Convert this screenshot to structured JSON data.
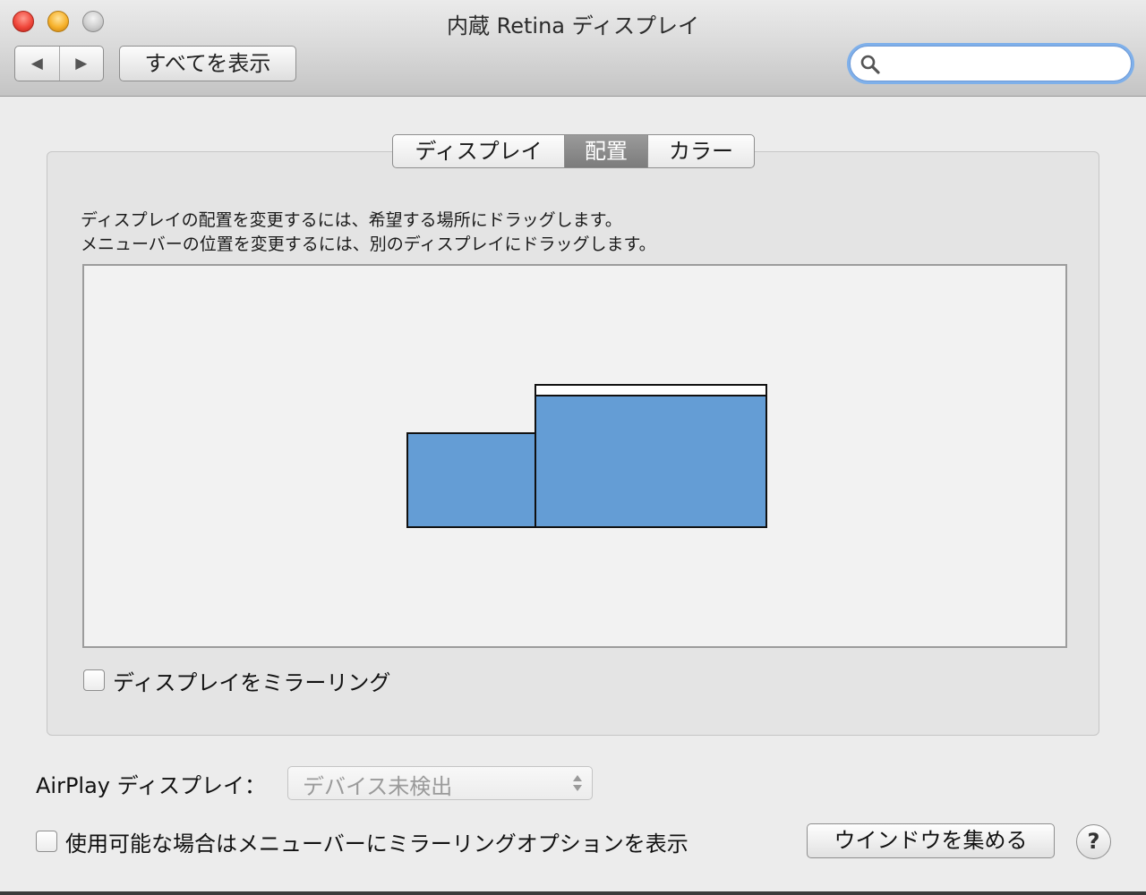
{
  "window": {
    "title": "内蔵 Retina ディスプレイ"
  },
  "toolbar": {
    "back_glyph": "◀",
    "forward_glyph": "▶",
    "show_all_label": "すべてを表示",
    "search": {
      "value": "",
      "placeholder": "",
      "icon": "search-icon"
    }
  },
  "tabs": [
    {
      "label": "ディスプレイ",
      "selected": false
    },
    {
      "label": "配置",
      "selected": true
    },
    {
      "label": "カラー",
      "selected": false
    }
  ],
  "arrangement": {
    "instruction_1": "ディスプレイの配置を変更するには、希望する場所にドラッグします。",
    "instruction_2": "メニューバーの位置を変更するには、別のディスプレイにドラッグします。",
    "display_color": "#649dd5",
    "displays": [
      {
        "id": "secondary",
        "has_menu_bar": false
      },
      {
        "id": "main",
        "has_menu_bar": true
      }
    ]
  },
  "mirror": {
    "label": "ディスプレイをミラーリング",
    "checked": false
  },
  "airplay": {
    "label": "AirPlay ディスプレイ：",
    "selected_value": "デバイス未検出",
    "enabled": false
  },
  "menu_option": {
    "label": "使用可能な場合はメニューバーにミラーリングオプションを表示",
    "checked": false
  },
  "gather_windows_label": "ウインドウを集める",
  "help_label": "?"
}
